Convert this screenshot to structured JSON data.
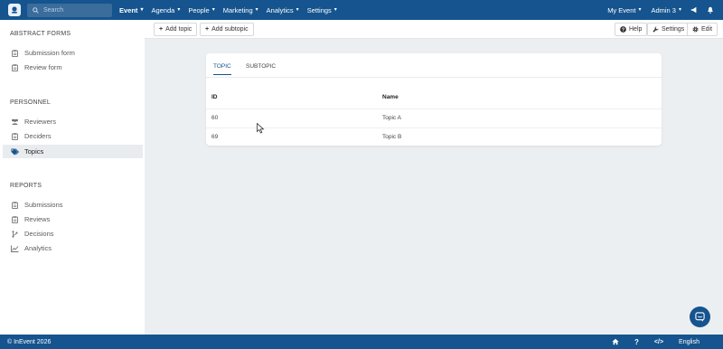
{
  "topbar": {
    "search_placeholder": "Search",
    "nav": [
      {
        "label": "Event"
      },
      {
        "label": "Agenda"
      },
      {
        "label": "People"
      },
      {
        "label": "Marketing"
      },
      {
        "label": "Analytics"
      },
      {
        "label": "Settings"
      }
    ],
    "my_event": "My Event",
    "user": "Admin 3"
  },
  "sidebar": {
    "sections": [
      {
        "title": "ABSTRACT FORMS",
        "items": [
          {
            "label": "Submission form",
            "icon": "clipboard-icon"
          },
          {
            "label": "Review form",
            "icon": "clipboard-icon"
          }
        ]
      },
      {
        "title": "PERSONNEL",
        "items": [
          {
            "label": "Reviewers",
            "icon": "users-icon"
          },
          {
            "label": "Deciders",
            "icon": "clipboard-icon"
          },
          {
            "label": "Topics",
            "icon": "tags-icon",
            "active": true
          }
        ]
      },
      {
        "title": "REPORTS",
        "items": [
          {
            "label": "Submissions",
            "icon": "clipboard-icon"
          },
          {
            "label": "Reviews",
            "icon": "clipboard-icon"
          },
          {
            "label": "Decisions",
            "icon": "branch-icon"
          },
          {
            "label": "Analytics",
            "icon": "chart-icon"
          }
        ]
      }
    ]
  },
  "toolbar": {
    "add_topic": "Add topic",
    "add_subtopic": "Add subtopic",
    "help": "Help",
    "settings": "Settings",
    "edit": "Edit"
  },
  "card": {
    "tabs": [
      {
        "label": "TOPIC",
        "active": true
      },
      {
        "label": "SUBTOPIC",
        "active": false
      }
    ],
    "columns": [
      "ID",
      "Name"
    ],
    "rows": [
      {
        "id": "60",
        "name": "Topic A"
      },
      {
        "id": "69",
        "name": "Topic B"
      }
    ]
  },
  "footer": {
    "copyright": "© InEvent 2026",
    "language": "English"
  },
  "colors": {
    "brand": "#15548e",
    "background": "#eceff1"
  }
}
